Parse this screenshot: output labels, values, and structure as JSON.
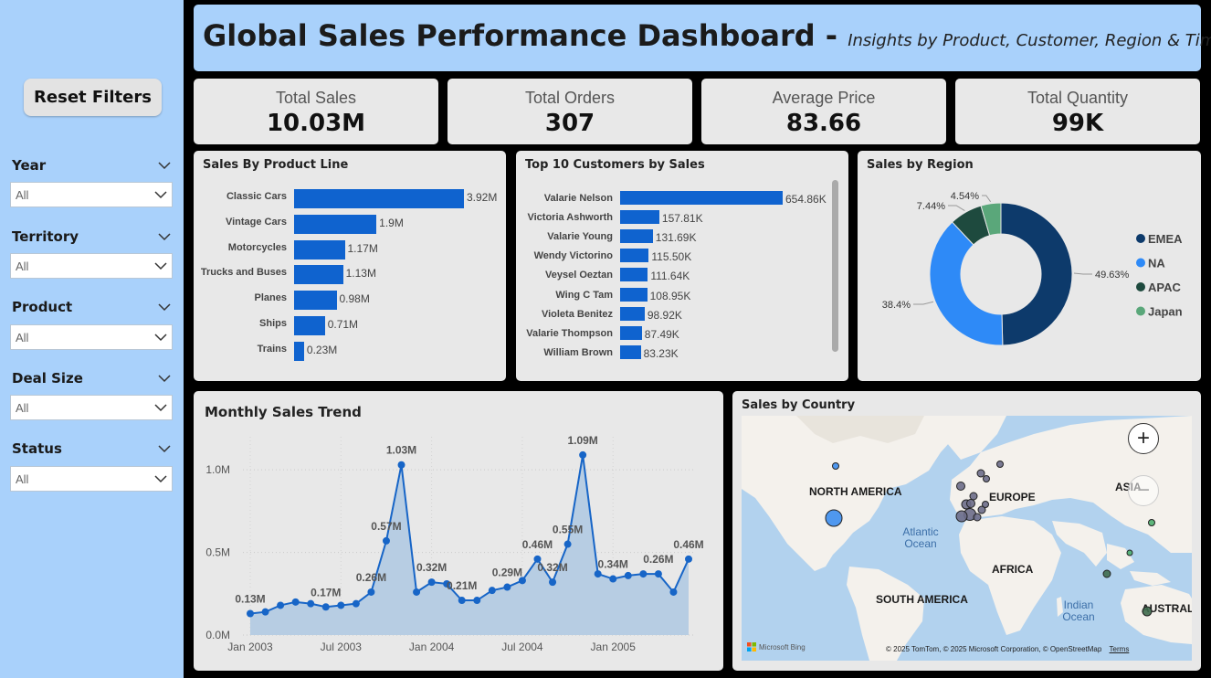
{
  "header": {
    "title": "Global Sales Performance Dashboard -",
    "subtitle": "Insights by Product, Customer, Region & Time"
  },
  "sidebar": {
    "reset_label": "Reset Filters",
    "filters": [
      {
        "label": "Year",
        "value": "All"
      },
      {
        "label": "Territory",
        "value": "All"
      },
      {
        "label": "Product",
        "value": "All"
      },
      {
        "label": "Deal Size",
        "value": "All"
      },
      {
        "label": "Status",
        "value": "All"
      }
    ]
  },
  "kpis": [
    {
      "label": "Total Sales",
      "value": "10.03M"
    },
    {
      "label": "Total Orders",
      "value": "307"
    },
    {
      "label": "Average Price",
      "value": "83.66"
    },
    {
      "label": "Total Quantity",
      "value": "99K"
    }
  ],
  "colors": {
    "sidebar_bg": "#a9d1fb",
    "bar_blue": "#0f63cf",
    "emea": "#0d3a6b",
    "na": "#2e8af7",
    "apac": "#1e4a3e",
    "japan": "#5aa77a"
  },
  "product_line": {
    "title": "Sales By Product Line",
    "display": [
      "3.92M",
      "1.9M",
      "1.17M",
      "1.13M",
      "0.98M",
      "0.71M",
      "0.23M"
    ]
  },
  "customers": {
    "title": "Top 10 Customers by Sales",
    "display": [
      "654.86K",
      "157.81K",
      "131.69K",
      "115.50K",
      "111.64K",
      "108.95K",
      "98.92K",
      "87.49K",
      "83.23K"
    ]
  },
  "region": {
    "title": "Sales by Region",
    "display": [
      "49.63%",
      "38.4%",
      "7.44%",
      "4.54%"
    ]
  },
  "trend": {
    "title": "Monthly Sales Trend",
    "point_labels": [
      {
        "i": 0,
        "text": "0.13M"
      },
      {
        "i": 5,
        "text": "0.17M"
      },
      {
        "i": 8,
        "text": "0.26M"
      },
      {
        "i": 9,
        "text": "0.57M"
      },
      {
        "i": 10,
        "text": "1.03M"
      },
      {
        "i": 12,
        "text": "0.32M"
      },
      {
        "i": 14,
        "text": "0.21M"
      },
      {
        "i": 17,
        "text": "0.29M"
      },
      {
        "i": 19,
        "text": "0.46M"
      },
      {
        "i": 20,
        "text": "0.32M"
      },
      {
        "i": 21,
        "text": "0.55M"
      },
      {
        "i": 22,
        "text": "1.09M"
      },
      {
        "i": 24,
        "text": "0.34M"
      },
      {
        "i": 27,
        "text": "0.26M"
      },
      {
        "i": 29,
        "text": "0.46M"
      }
    ]
  },
  "map": {
    "title": "Sales by Country",
    "labels": {
      "north_america": "NORTH AMERICA",
      "europe": "EUROPE",
      "asia": "ASIA",
      "africa": "AFRICA",
      "south_america": "SOUTH AMERICA",
      "australia": "AUSTRALI",
      "atlantic": "Atlantic Ocean",
      "indian": "Indian Ocean"
    },
    "bing": "Microsoft Bing",
    "attribution": "© 2025 TomTom, © 2025 Microsoft Corporation, © OpenStreetMap",
    "terms": "Terms",
    "zoom_in": "+",
    "zoom_out": "−"
  },
  "chart_data": [
    {
      "type": "bar",
      "title": "Sales By Product Line",
      "orientation": "horizontal",
      "categories": [
        "Classic Cars",
        "Vintage Cars",
        "Motorcycles",
        "Trucks and Buses",
        "Planes",
        "Ships",
        "Trains"
      ],
      "values": [
        3.92,
        1.9,
        1.17,
        1.13,
        0.98,
        0.71,
        0.23
      ],
      "unit": "M"
    },
    {
      "type": "bar",
      "title": "Top 10 Customers by Sales",
      "orientation": "horizontal",
      "categories": [
        "Valarie Nelson",
        "Victoria Ashworth",
        "Valarie Young",
        "Wendy Victorino",
        "Veysel Oeztan",
        "Wing C Tam",
        "Violeta Benitez",
        "Valarie Thompson",
        "William Brown"
      ],
      "values": [
        654.86,
        157.81,
        131.69,
        115.5,
        111.64,
        108.95,
        98.92,
        87.49,
        83.23
      ],
      "unit": "K"
    },
    {
      "type": "pie",
      "title": "Sales by Region",
      "categories": [
        "EMEA",
        "NA",
        "APAC",
        "Japan"
      ],
      "values": [
        49.63,
        38.4,
        7.44,
        4.54
      ],
      "legend": "right"
    },
    {
      "type": "area",
      "title": "Monthly Sales Trend",
      "x": [
        "2003-01",
        "2003-02",
        "2003-03",
        "2003-04",
        "2003-05",
        "2003-06",
        "2003-07",
        "2003-08",
        "2003-09",
        "2003-10",
        "2003-11",
        "2003-12",
        "2004-01",
        "2004-02",
        "2004-03",
        "2004-04",
        "2004-05",
        "2004-06",
        "2004-07",
        "2004-08",
        "2004-09",
        "2004-10",
        "2004-11",
        "2004-12",
        "2005-01",
        "2005-02",
        "2005-03",
        "2005-04",
        "2005-05",
        "2005-06"
      ],
      "y": [
        0.13,
        0.14,
        0.18,
        0.2,
        0.19,
        0.17,
        0.18,
        0.19,
        0.26,
        0.57,
        1.03,
        0.26,
        0.32,
        0.31,
        0.21,
        0.21,
        0.27,
        0.29,
        0.33,
        0.46,
        0.32,
        0.55,
        1.09,
        0.37,
        0.34,
        0.36,
        0.37,
        0.37,
        0.26,
        0.46
      ],
      "unit": "M",
      "ylim": [
        0,
        1.2
      ],
      "yticks": [
        "0.0M",
        "0.5M",
        "1.0M"
      ],
      "xticks": [
        "Jan 2003",
        "Jul 2003",
        "Jan 2004",
        "Jul 2004",
        "Jan 2005"
      ],
      "grid": true
    }
  ]
}
